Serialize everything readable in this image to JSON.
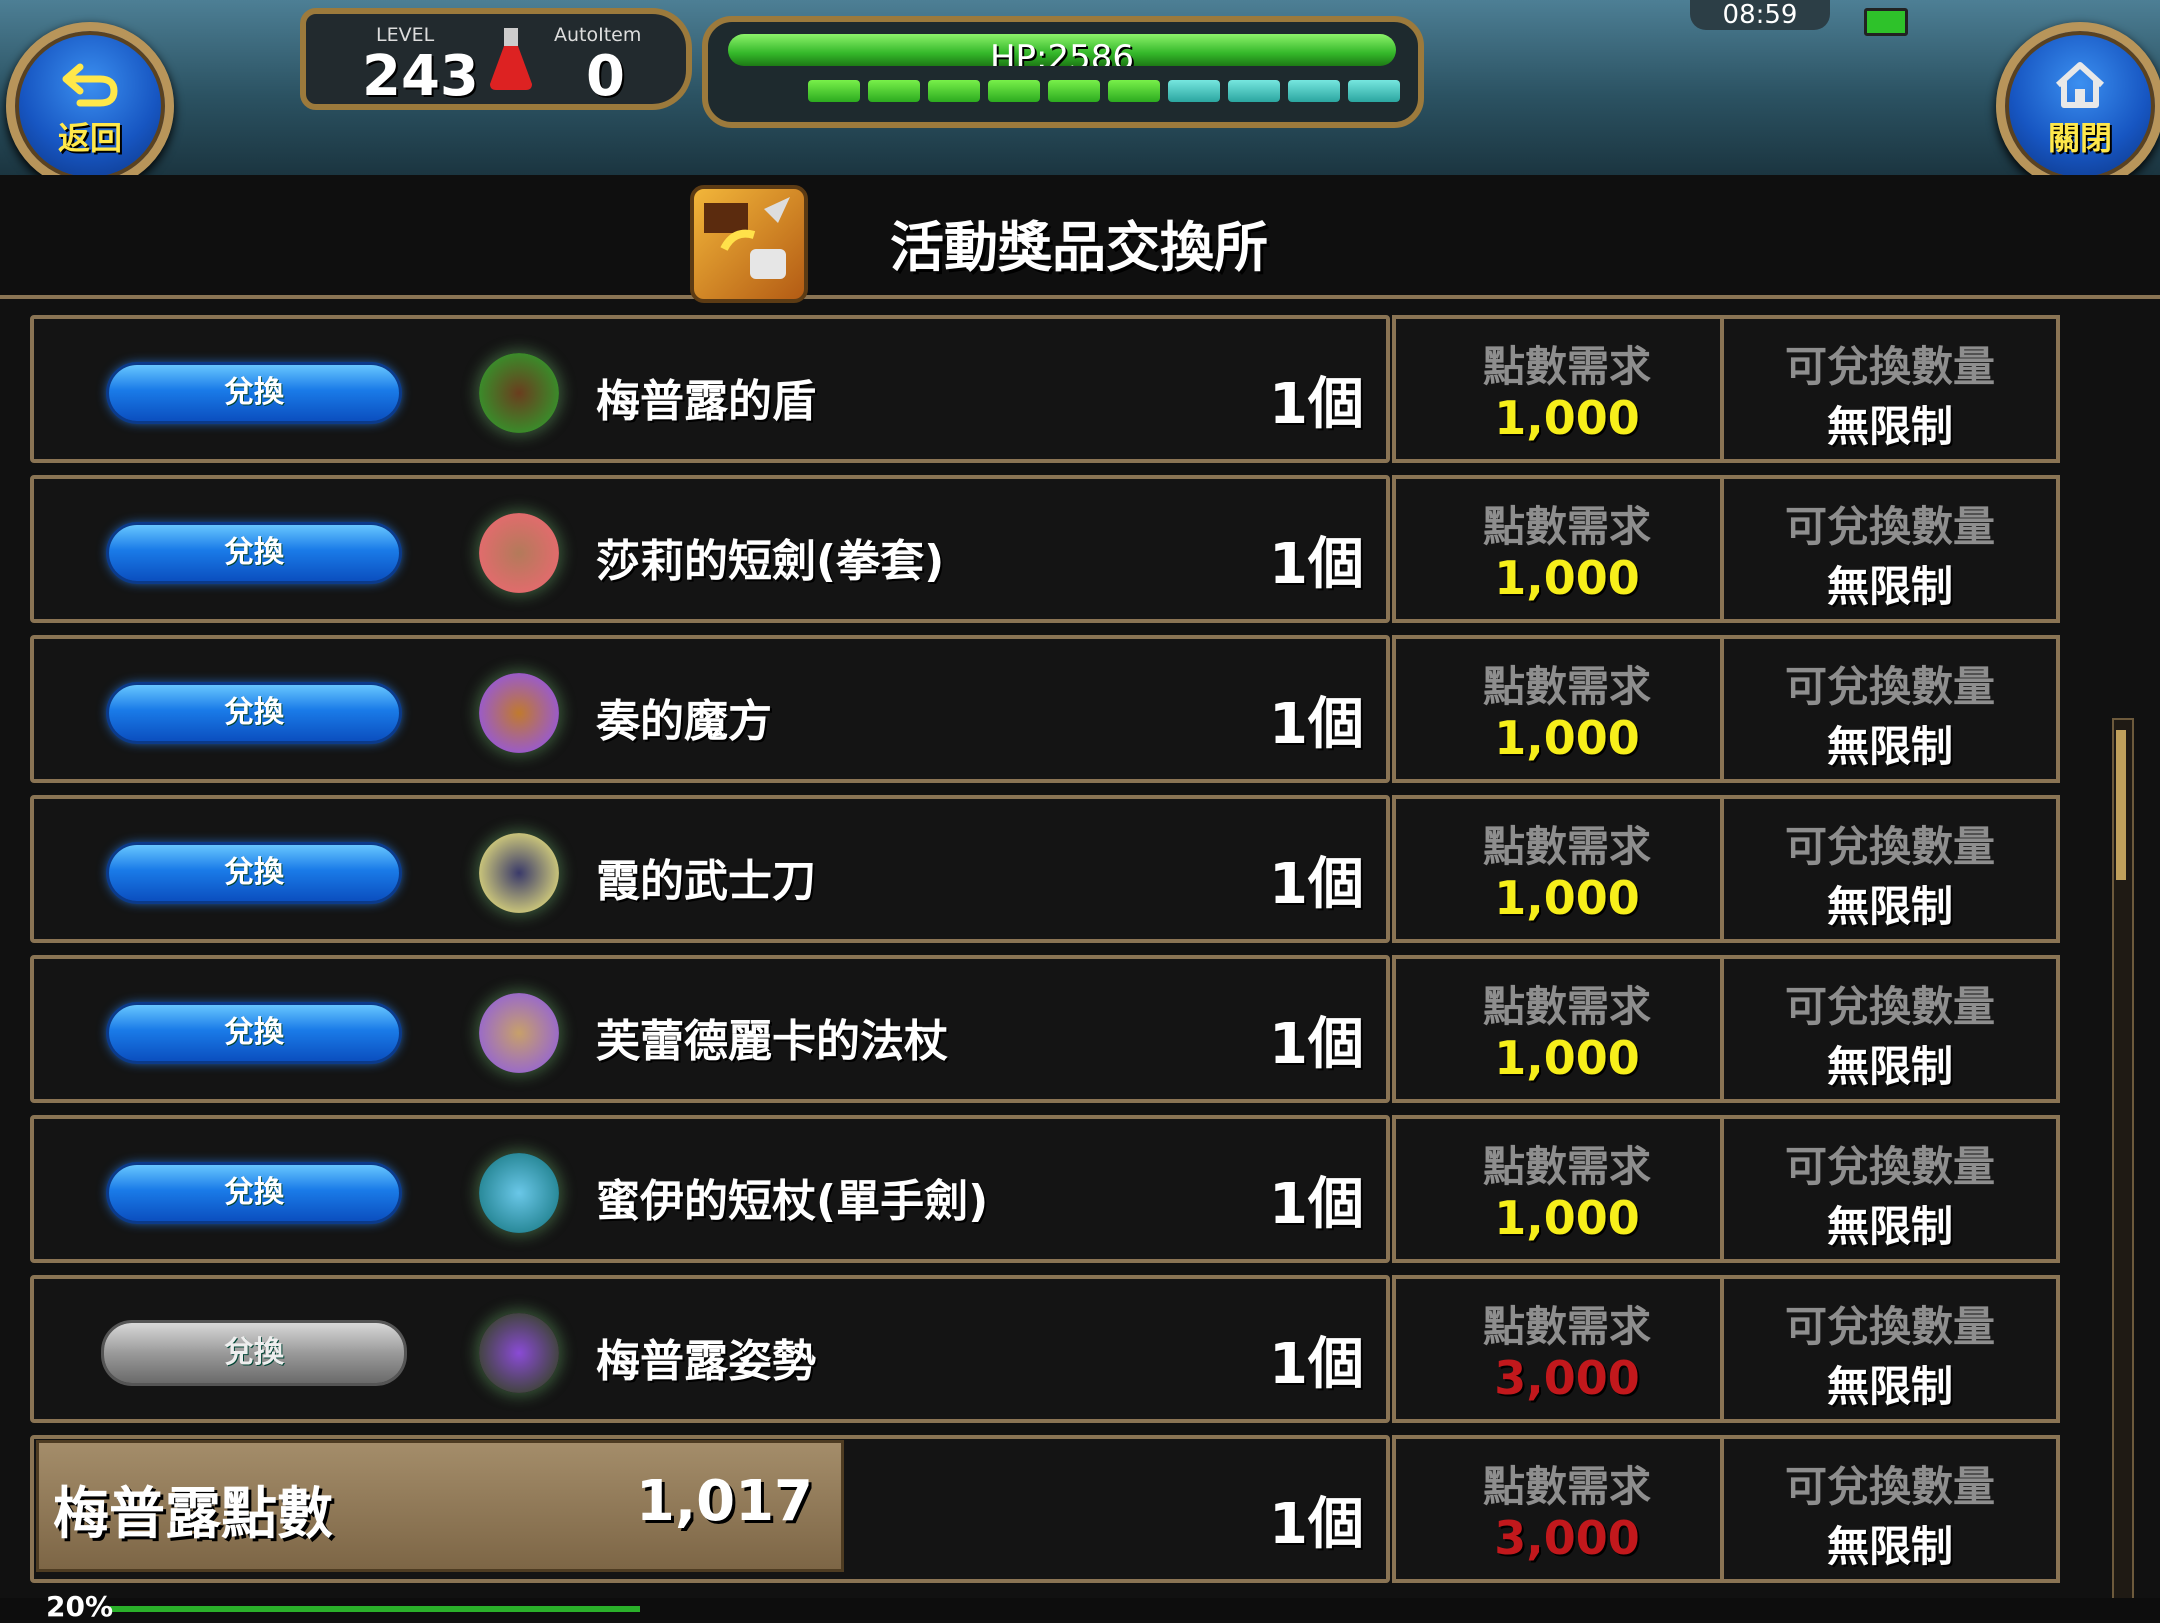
{
  "header": {
    "back_label": "返回",
    "close_label": "關閉",
    "level_caption": "LEVEL",
    "level_value": "243",
    "autoitem_caption": "AutoItem",
    "autoitem_value": "0",
    "hp_text": "HP:2586",
    "hp_fraction": 1.0,
    "stamina_full": 6,
    "stamina_total": 10,
    "clock": "08:59"
  },
  "title": "活動獎品交換所",
  "columns": {
    "cost_label": "點數需求",
    "limit_label": "可兌換數量"
  },
  "items": [
    {
      "button": "兌換",
      "enabled": true,
      "name": "梅普露的盾",
      "qty": "1個",
      "cost": "1,000",
      "limit": "無限制",
      "icon": "shield-icon"
    },
    {
      "button": "兌換",
      "enabled": true,
      "name": "莎莉的短劍(拳套)",
      "qty": "1個",
      "cost": "1,000",
      "limit": "無限制",
      "icon": "gauntlet-icon"
    },
    {
      "button": "兌換",
      "enabled": true,
      "name": "奏的魔方",
      "qty": "1個",
      "cost": "1,000",
      "limit": "無限制",
      "icon": "cube-icon"
    },
    {
      "button": "兌換",
      "enabled": true,
      "name": "霞的武士刀",
      "qty": "1個",
      "cost": "1,000",
      "limit": "無限制",
      "icon": "katana-icon"
    },
    {
      "button": "兌換",
      "enabled": true,
      "name": "芙蕾德麗卡的法杖",
      "qty": "1個",
      "cost": "1,000",
      "limit": "無限制",
      "icon": "staff-icon"
    },
    {
      "button": "兌換",
      "enabled": true,
      "name": "蜜伊的短杖(單手劍)",
      "qty": "1個",
      "cost": "1,000",
      "limit": "無限制",
      "icon": "sword-icon"
    },
    {
      "button": "兌換",
      "enabled": false,
      "name": "梅普露姿勢",
      "qty": "1個",
      "cost": "3,000",
      "limit": "無限制",
      "icon": "pose-icon"
    },
    {
      "button": "",
      "enabled": false,
      "name": "",
      "qty": "1個",
      "cost": "3,000",
      "limit": "無限制",
      "icon": ""
    }
  ],
  "points": {
    "label": "梅普露點數",
    "value": "1,017"
  },
  "footer": {
    "exp_text": "20%"
  },
  "colors": {
    "affordable": "#f6ee1a",
    "unaffordable": "#c2181c",
    "frame_gold": "#8a7454"
  }
}
